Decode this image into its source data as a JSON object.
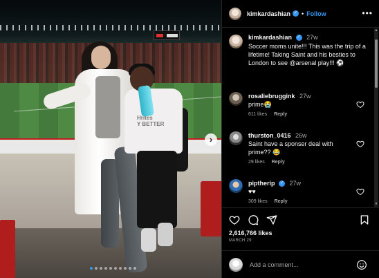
{
  "post": {
    "username": "kimkardashian",
    "follow_label": "Follow",
    "more_label": "•••",
    "caption": {
      "username": "kimkardashian",
      "time": "27w",
      "text": "Soccer moms unite!!! This was the trip of a lifetime! Taking Saint and his besties to London to see @arsenal play!!! ⚽"
    },
    "comments": [
      {
        "username": "rosaliebruggink",
        "time": "27w",
        "text": "prime😭",
        "likes": "611 likes",
        "reply": "Reply",
        "verified": false
      },
      {
        "username": "thurston_0416",
        "time": "26w",
        "text": "Saint have a sponser deal with prime?? 😂",
        "likes": "29 likes",
        "reply": "Reply",
        "verified": false
      },
      {
        "username": "piptherip",
        "time": "27w",
        "text": "♥♥",
        "likes": "309 likes",
        "reply": "Reply",
        "verified": true
      }
    ],
    "likes_count": "2,616,766 likes",
    "date": "MARCH 29",
    "comment_placeholder": "Add a comment...",
    "photo": {
      "shirt_text": "Hrites\nY BETTER",
      "next_arrow": "›",
      "carousel_count": 10,
      "carousel_active": 0
    }
  },
  "icons": {
    "verified": "verified-check-icon",
    "heart": "heart-outline-icon",
    "comment": "comment-icon",
    "share": "paper-plane-icon",
    "save": "bookmark-icon",
    "emoji": "smiley-icon"
  },
  "colors": {
    "accent": "#3797f0",
    "background": "#000000",
    "muted_text": "#a8a8a8"
  }
}
